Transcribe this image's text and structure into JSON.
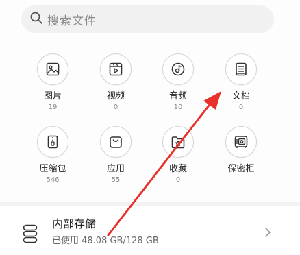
{
  "search": {
    "placeholder": "搜索文件",
    "icon": "search-icon"
  },
  "categories": [
    {
      "label": "图片",
      "count": "19",
      "icon": "image-icon"
    },
    {
      "label": "视频",
      "count": "0",
      "icon": "video-icon"
    },
    {
      "label": "音频",
      "count": "10",
      "icon": "audio-icon"
    },
    {
      "label": "文档",
      "count": "0",
      "icon": "document-icon"
    },
    {
      "label": "压缩包",
      "count": "546",
      "icon": "archive-icon"
    },
    {
      "label": "应用",
      "count": "55",
      "icon": "app-bag-icon"
    },
    {
      "label": "收藏",
      "count": "0",
      "icon": "favorites-folder-icon"
    },
    {
      "label": "保密柜",
      "count": "",
      "icon": "safe-icon"
    }
  ],
  "storage": {
    "title": "内部存储",
    "used_text": "已使用 48.08 GB/128 GB",
    "icon": "storage-icon"
  },
  "colors": {
    "annotation_arrow": "#e8312a"
  }
}
